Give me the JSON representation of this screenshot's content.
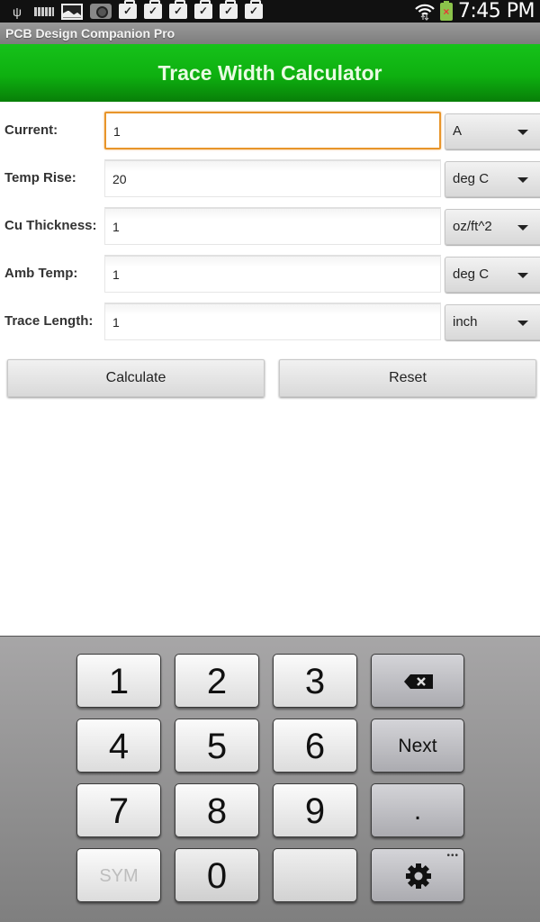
{
  "status_bar": {
    "left_icons": [
      "usb-icon",
      "keyboard-icon",
      "picture-icon",
      "camera-icon",
      "task-bag-icon",
      "task-bag-icon",
      "task-bag-icon",
      "task-bag-icon",
      "task-bag-icon",
      "task-bag-icon"
    ],
    "right_icons": [
      "wifi-icon",
      "battery-charging-error-icon"
    ],
    "time": "7:45 PM"
  },
  "app": {
    "title": "PCB Design Companion Pro"
  },
  "header": {
    "title": "Trace Width Calculator",
    "color": "#0eb010"
  },
  "form": {
    "rows": [
      {
        "label": "Current:",
        "value": "1",
        "unit": "A",
        "focused": true
      },
      {
        "label": "Temp Rise:",
        "value": "20",
        "unit": "deg C",
        "focused": false
      },
      {
        "label": "Cu Thickness:",
        "value": "1",
        "unit": "oz/ft^2",
        "focused": false
      },
      {
        "label": "Amb Temp:",
        "value": "1",
        "unit": "deg C",
        "focused": false
      },
      {
        "label": "Trace Length:",
        "value": "1",
        "unit": "inch",
        "focused": false
      }
    ],
    "calculate_label": "Calculate",
    "reset_label": "Reset",
    "focus_color": "#e8952a"
  },
  "keyboard": {
    "rows": [
      [
        "1",
        "2",
        "3",
        "backspace"
      ],
      [
        "4",
        "5",
        "6",
        "Next"
      ],
      [
        "7",
        "8",
        "9",
        "."
      ],
      [
        "SYM",
        "0",
        "",
        "settings"
      ]
    ],
    "next_label": "Next",
    "sym_label": "SYM",
    "dot_label": ".",
    "more_indicator": "•••"
  }
}
